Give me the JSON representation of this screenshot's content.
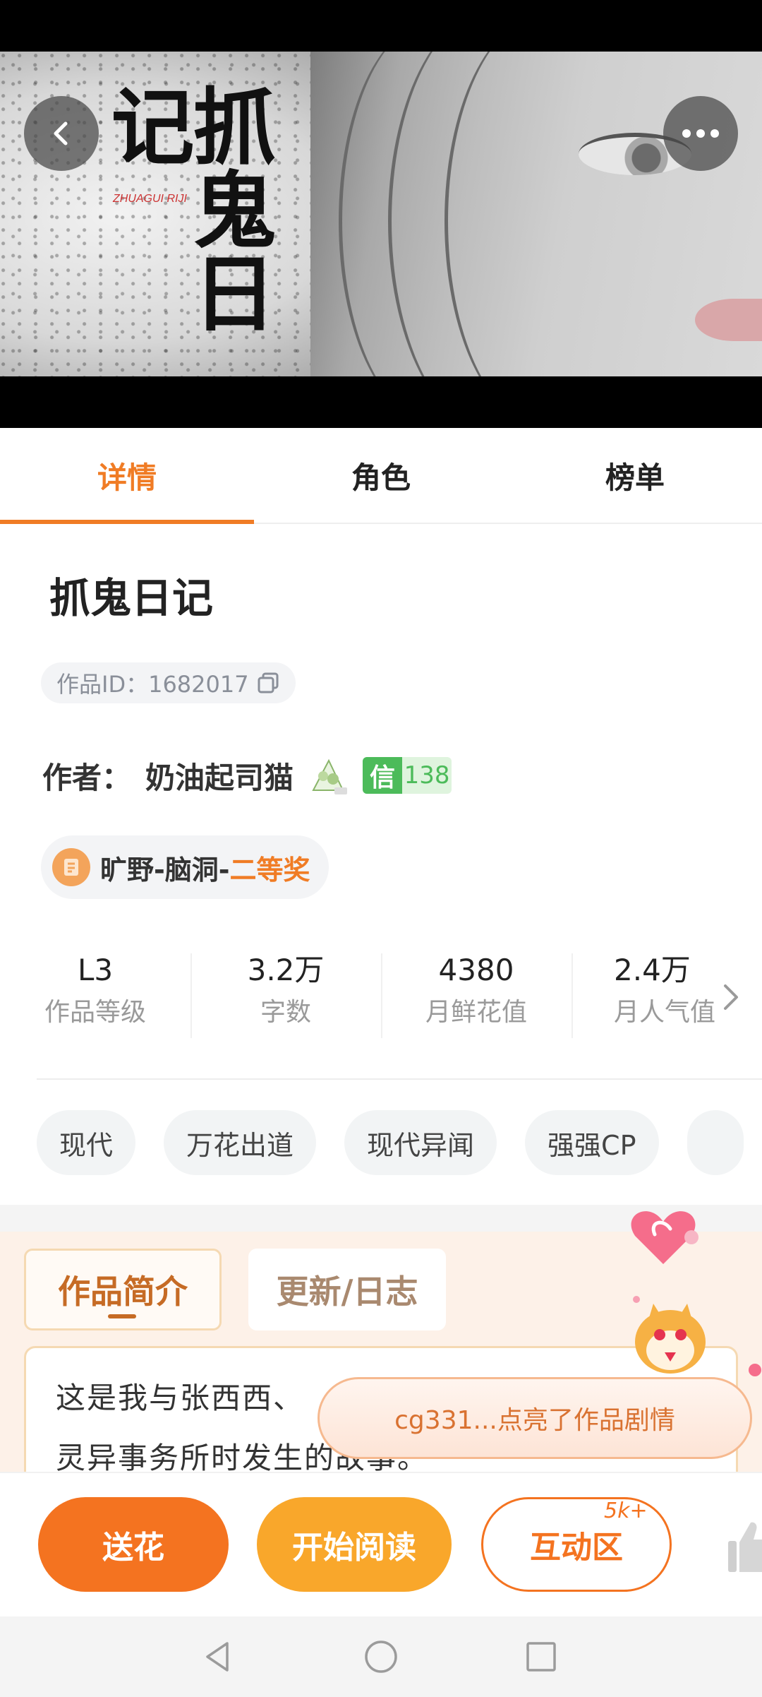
{
  "banner": {
    "title": "抓鬼日记",
    "subtitle": "ZHUAGUI RIJI"
  },
  "tabs": [
    {
      "label": "详情"
    },
    {
      "label": "角色"
    },
    {
      "label": "榜单"
    }
  ],
  "work": {
    "title": "抓鬼日记",
    "id_text": "作品ID：1682017",
    "author_label": "作者：",
    "author_name": "奶油起司猫",
    "credit_icon": "信",
    "credit_value": "138",
    "award_prefix": "旷野-脑洞-",
    "award_rank": "二等奖"
  },
  "stats": [
    {
      "value": "L3",
      "label": "作品等级"
    },
    {
      "value": "3.2万",
      "label": "字数"
    },
    {
      "value": "4380",
      "label": "月鲜花值"
    },
    {
      "value": "2.4万",
      "label": "月人气值"
    }
  ],
  "tags": [
    "现代",
    "万花出道",
    "现代异闻",
    "强强CP"
  ],
  "intro": {
    "tab_active": "作品简介",
    "tab_other": "更新/日志",
    "text_line1": "这是我与张西西、",
    "text_line2": "灵异事务所时发生的故事。"
  },
  "toast": {
    "text": "cg331...点亮了作品剧情"
  },
  "bottom_bar": {
    "flower_label": "送花",
    "read_label": "开始阅读",
    "interact_label": "互动区",
    "interact_badge": "5k+"
  },
  "colors": {
    "accent": "#f07c25",
    "read_button": "#f9a72b",
    "credit_green": "#4cbb5a"
  },
  "icons": [
    "back-icon",
    "more-icon",
    "copy-icon",
    "author-badge-icon",
    "award-icon",
    "chevron-right-icon",
    "like-icon",
    "nav-back-icon",
    "nav-home-icon",
    "nav-recents-icon"
  ]
}
